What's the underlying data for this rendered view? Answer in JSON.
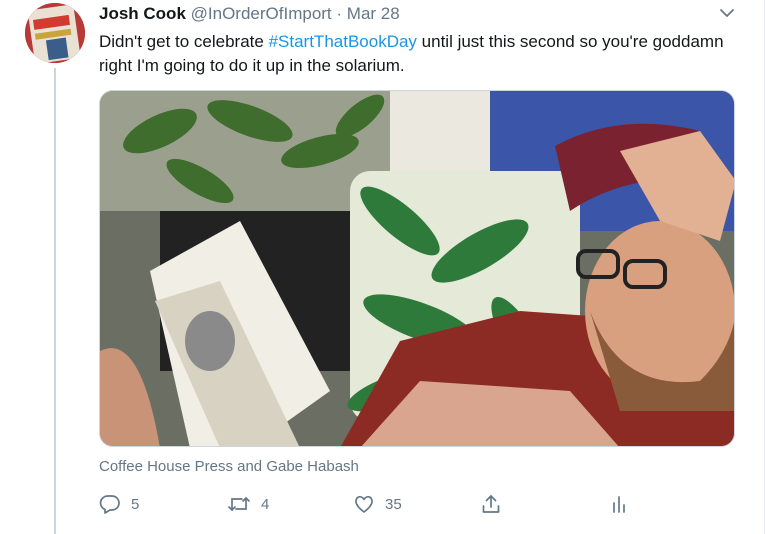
{
  "tweet": {
    "display_name": "Josh Cook",
    "handle": "@InOrderOfImport",
    "dot": "·",
    "date": "Mar 28",
    "text_before": "Didn't get to celebrate ",
    "hashtag": "#StartThatBookDay",
    "text_after": " until just this second so you're goddamn right I'm going to do it up in the solarium.",
    "media_caption": "Coffee House Press and Gabe Habash",
    "actions": {
      "reply_count": "5",
      "retweet_count": "4",
      "like_count": "35"
    }
  },
  "colors": {
    "link": "#1b95e0",
    "secondary_text": "#657786",
    "primary_text": "#14171a"
  },
  "icons": [
    "chevron-down-icon",
    "reply-icon",
    "retweet-icon",
    "like-icon",
    "share-icon",
    "analytics-icon"
  ]
}
